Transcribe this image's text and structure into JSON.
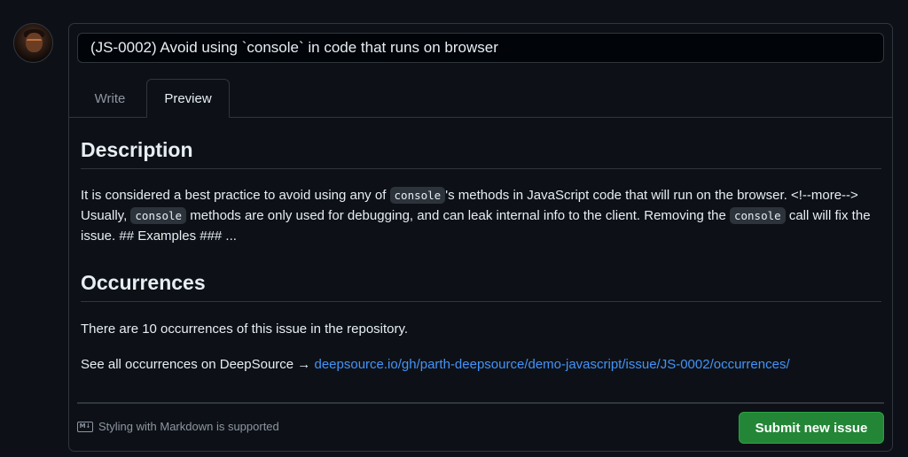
{
  "issue": {
    "title": "(JS-0002) Avoid using `console` in code that runs on browser"
  },
  "tabs": {
    "write": "Write",
    "preview": "Preview"
  },
  "description": {
    "heading": "Description",
    "text1": "It is considered a best practice to avoid using any of ",
    "code1": "console",
    "text2": "'s methods in JavaScript code that will run on the browser. <!--more--> Usually, ",
    "code2": "console",
    "text3": " methods are only used for debugging, and can leak internal info to the client. Removing the ",
    "code3": "console",
    "text4": " call will fix the issue. ## Examples ### ..."
  },
  "occurrences": {
    "heading": "Occurrences",
    "count_text": "There are 10 occurrences of this issue in the repository.",
    "link_prefix": "See all occurrences on DeepSource → ",
    "link_text": "deepsource.io/gh/parth-deepsource/demo-javascript/issue/JS-0002/occurrences/"
  },
  "footer": {
    "markdown_icon": "M↓",
    "markdown_hint": "Styling with Markdown is supported",
    "submit_label": "Submit new issue"
  },
  "colors": {
    "background": "#0d1117",
    "border": "#30363d",
    "link": "#4493f8",
    "submit": "#238636"
  }
}
